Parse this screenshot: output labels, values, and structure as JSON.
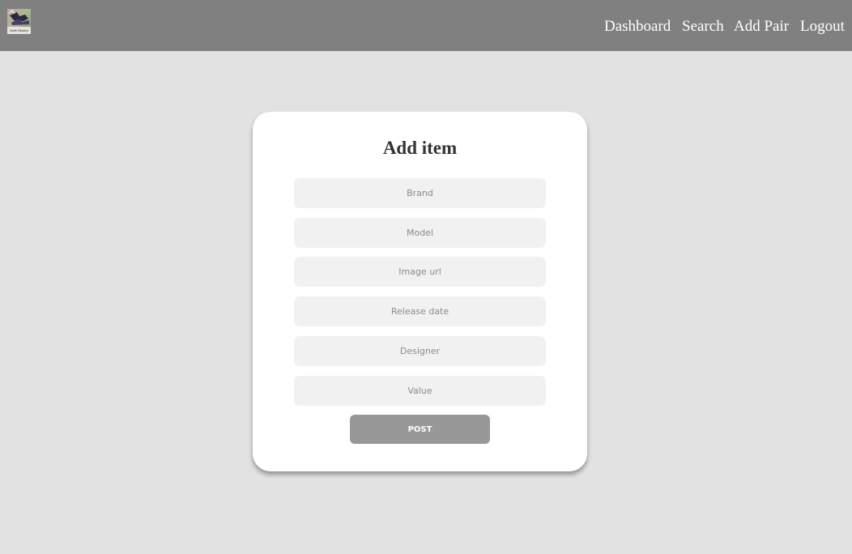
{
  "navbar": {
    "logo_text": "Sole Mates",
    "links": [
      "Dashboard",
      "Search",
      "Add Pair",
      "Logout"
    ]
  },
  "form": {
    "title": "Add item",
    "fields": [
      {
        "placeholder": "Brand",
        "value": ""
      },
      {
        "placeholder": "Model",
        "value": ""
      },
      {
        "placeholder": "Image url",
        "value": ""
      },
      {
        "placeholder": "Release date",
        "value": ""
      },
      {
        "placeholder": "Designer",
        "value": ""
      },
      {
        "placeholder": "Value",
        "value": ""
      }
    ],
    "submit_label": "POST"
  },
  "colors": {
    "navbar_bg": "#7f807f",
    "page_bg": "#e2e2e2",
    "card_bg": "#ffffff",
    "field_bg": "#f1f1f1",
    "button_bg": "#979897"
  }
}
